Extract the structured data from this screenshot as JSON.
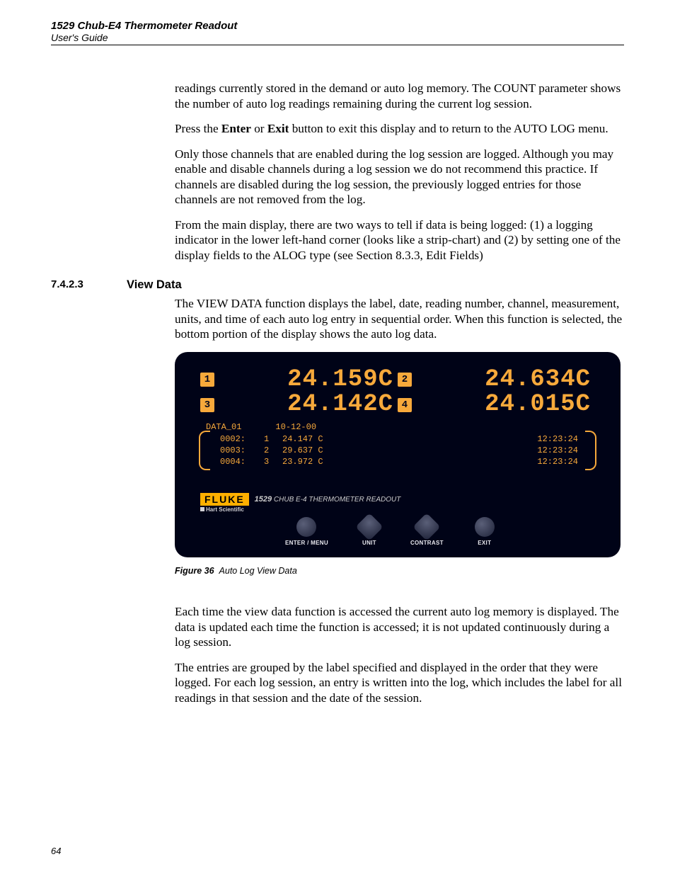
{
  "header": {
    "title": "1529 Chub-E4 Thermometer Readout",
    "subtitle": "User's Guide"
  },
  "para1": "readings currently stored in the demand or auto log memory. The COUNT parameter shows the number of auto log readings remaining during the current log session.",
  "para2_a": "Press the ",
  "para2_b1": "Enter",
  "para2_mid": " or ",
  "para2_b2": "Exit",
  "para2_c": " button to exit this display and to return to the AUTO LOG menu.",
  "para3": "Only those channels that are enabled during the log session are logged. Although you may enable and disable channels during a log session we do not recommend this practice. If channels are disabled during the log session, the previously logged entries for those channels are not removed from the log.",
  "para4": "From the main display, there are two ways to tell if data is being logged: (1) a logging indicator in the lower left-hand corner (looks like a strip-chart) and (2) by setting one of the display fields to the ALOG type (see Section 8.3.3, Edit Fields)",
  "section": {
    "num": "7.4.2.3",
    "title": "View Data"
  },
  "para5": "The VIEW DATA function displays the label, date, reading number, channel, measurement, units, and time of each auto log entry in sequential order. When this function is selected, the bottom portion of the display shows the auto log data.",
  "device": {
    "readouts": [
      {
        "ch": "1",
        "val": "24.159C"
      },
      {
        "ch": "2",
        "val": "24.634C"
      },
      {
        "ch": "3",
        "val": "24.142C"
      },
      {
        "ch": "4",
        "val": "24.015C"
      }
    ],
    "log_label": "DATA_01",
    "log_date": "10-12-00",
    "log_rows": [
      {
        "idx": "0002:",
        "ch": "1",
        "reading": "24.147 C",
        "time": "12:23:24"
      },
      {
        "idx": "0003:",
        "ch": "2",
        "reading": "29.637 C",
        "time": "12:23:24"
      },
      {
        "idx": "0004:",
        "ch": "3",
        "reading": "23.972 C",
        "time": "12:23:24"
      }
    ],
    "brand": "FLUKE",
    "sub_brand": "Hart Scientific",
    "model_bold": "1529",
    "model_text": " CHUB E-4 THERMOMETER READOUT",
    "buttons": [
      "ENTER / MENU",
      "UNIT",
      "CONTRAST",
      "EXIT"
    ]
  },
  "figure": {
    "label": "Figure 36",
    "caption": "Auto Log View Data"
  },
  "para6": "Each time the view data function is accessed the current auto log memory is displayed.  The data is updated each time the function is accessed; it is not updated continuously during a log session.",
  "para7": "The entries are grouped by the label specified and displayed in the order that they were logged. For each log session, an entry is written into the log, which includes the label for all readings in that session and the date of the session.",
  "page_number": "64"
}
